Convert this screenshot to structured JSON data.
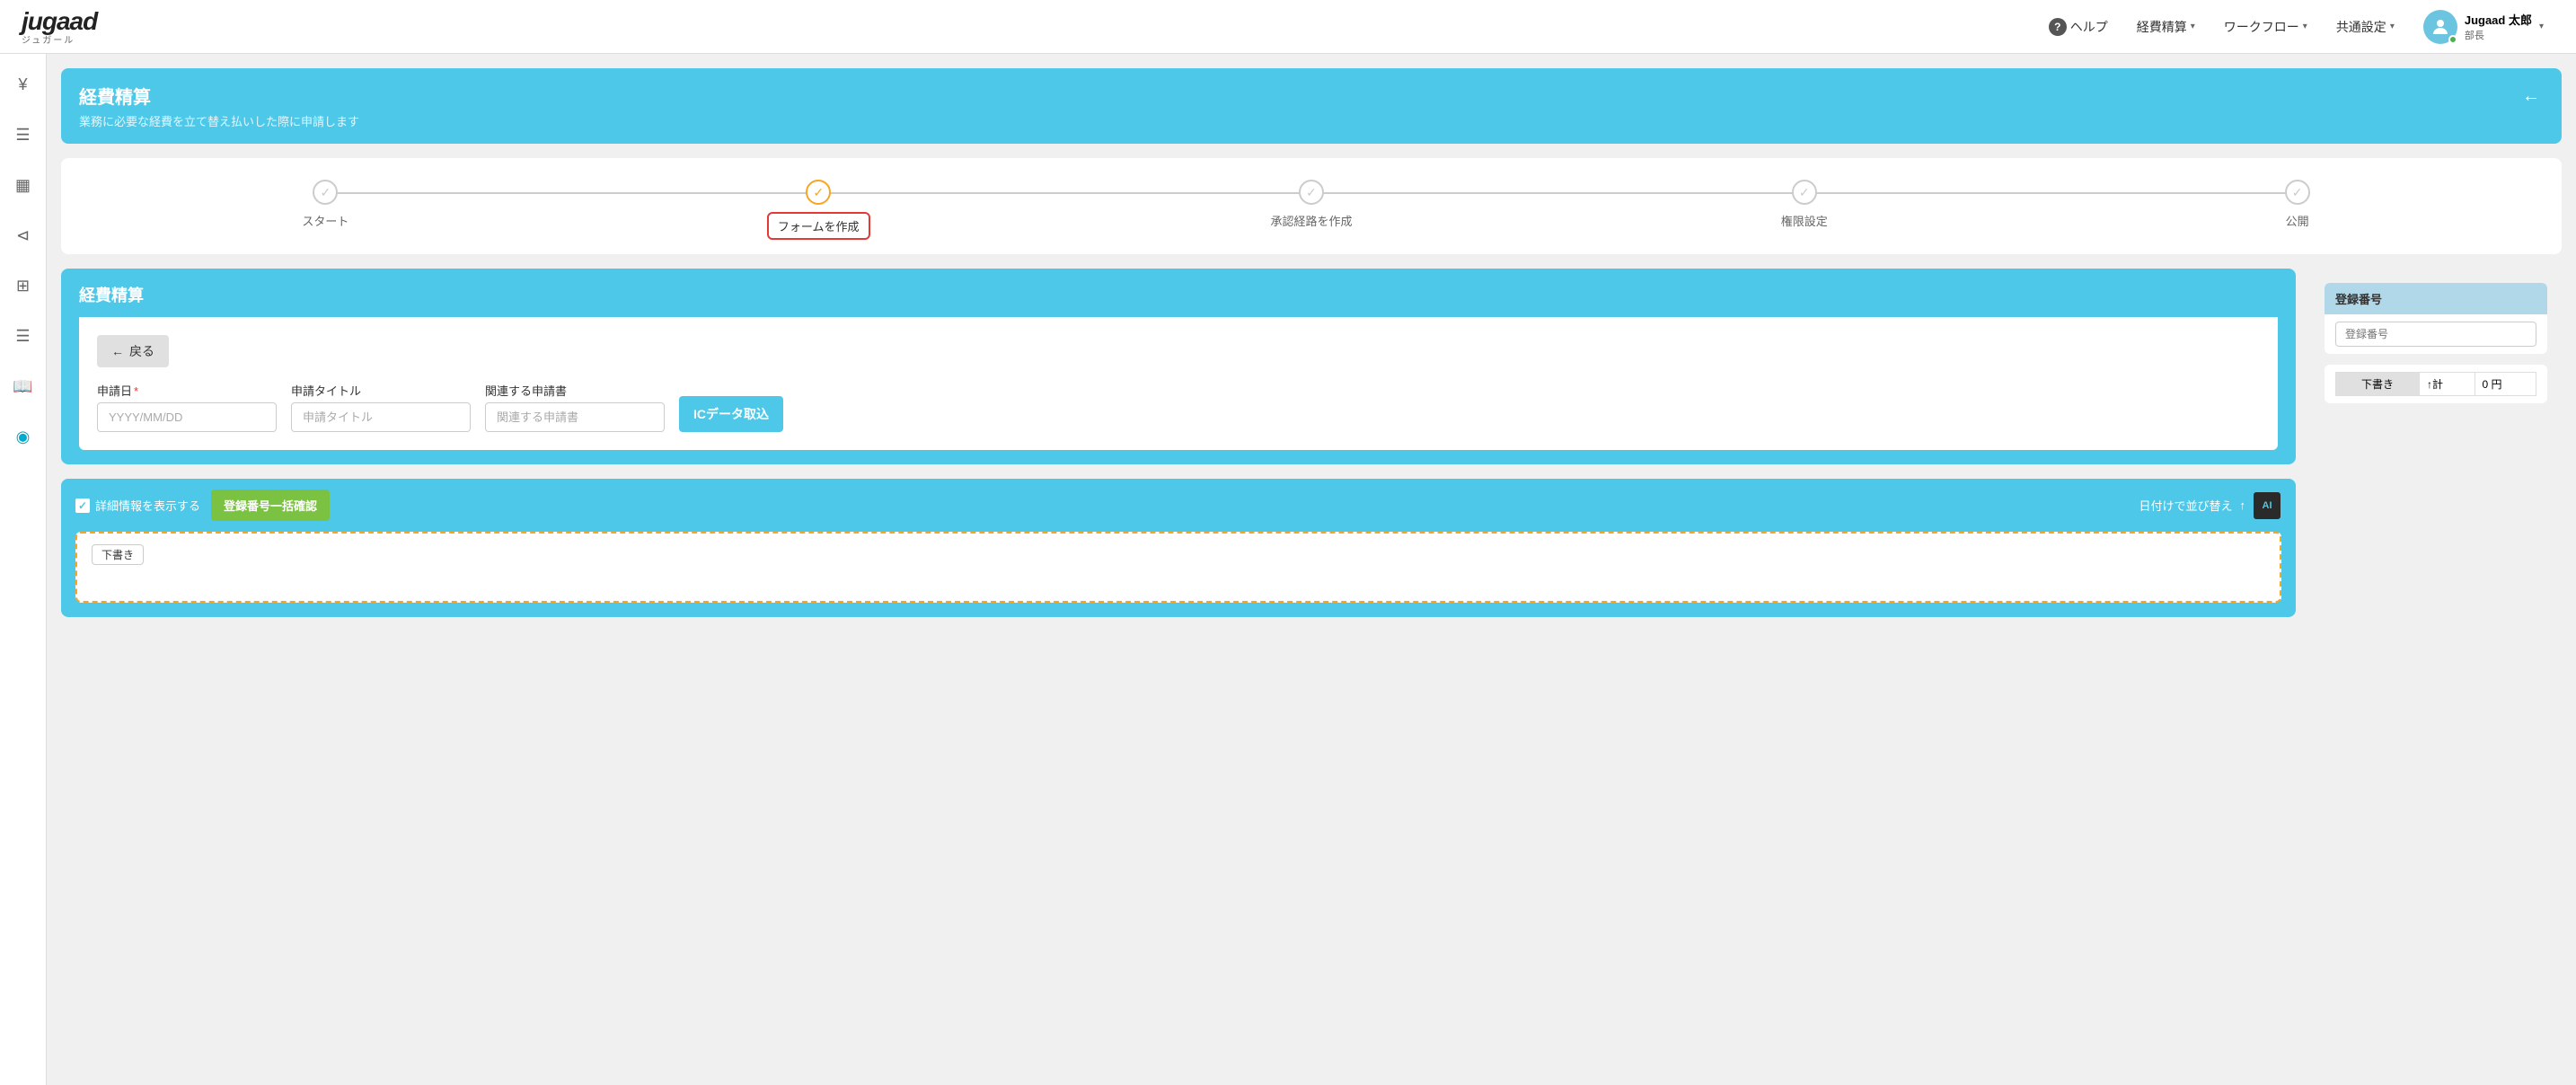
{
  "logo": {
    "text": "jugaad",
    "sub": "ジュガール"
  },
  "nav": {
    "help": "ヘルプ",
    "expense": "経費精算",
    "workflow": "ワークフロー",
    "settings": "共通設定",
    "user_name": "Jugaad 太郎",
    "user_role": "部長"
  },
  "sidebar": {
    "icons": [
      "¥",
      "☰",
      "▦",
      "⊲",
      "⋯",
      "⊞",
      "☰",
      "📖",
      "◉"
    ]
  },
  "header": {
    "title": "経費精算",
    "subtitle": "業務に必要な経費を立て替え払いした際に申請します",
    "back_icon": "←"
  },
  "stepper": {
    "steps": [
      {
        "label": "スタート",
        "state": "done"
      },
      {
        "label": "フォームを作成",
        "state": "active"
      },
      {
        "label": "承認経路を作成",
        "state": "done"
      },
      {
        "label": "権限設定",
        "state": "done"
      },
      {
        "label": "公開",
        "state": "done"
      }
    ]
  },
  "form_section": {
    "title": "経費精算",
    "back_btn": "戻る",
    "fields": {
      "date_label": "申請日",
      "date_placeholder": "YYYY/MM/DD",
      "title_label": "申請タイトル",
      "title_placeholder": "申請タイトル",
      "related_label": "関連する申請書",
      "related_placeholder": "関連する申請書",
      "ic_btn": "ICデータ取込"
    }
  },
  "detail_section": {
    "checkbox_label": "詳細情報を表示する",
    "confirm_btn": "登録番号一括確認",
    "sort_label": "日付けで並び替え",
    "sort_icon": "↑",
    "ai_label": "AI",
    "draft_tag": "下書き"
  },
  "right_panel": {
    "reg_number": {
      "header": "登録番号",
      "placeholder": "登録番号"
    },
    "status_table": {
      "status_label": "下書き",
      "count_label": "↑計",
      "count_value": "0 円"
    }
  }
}
